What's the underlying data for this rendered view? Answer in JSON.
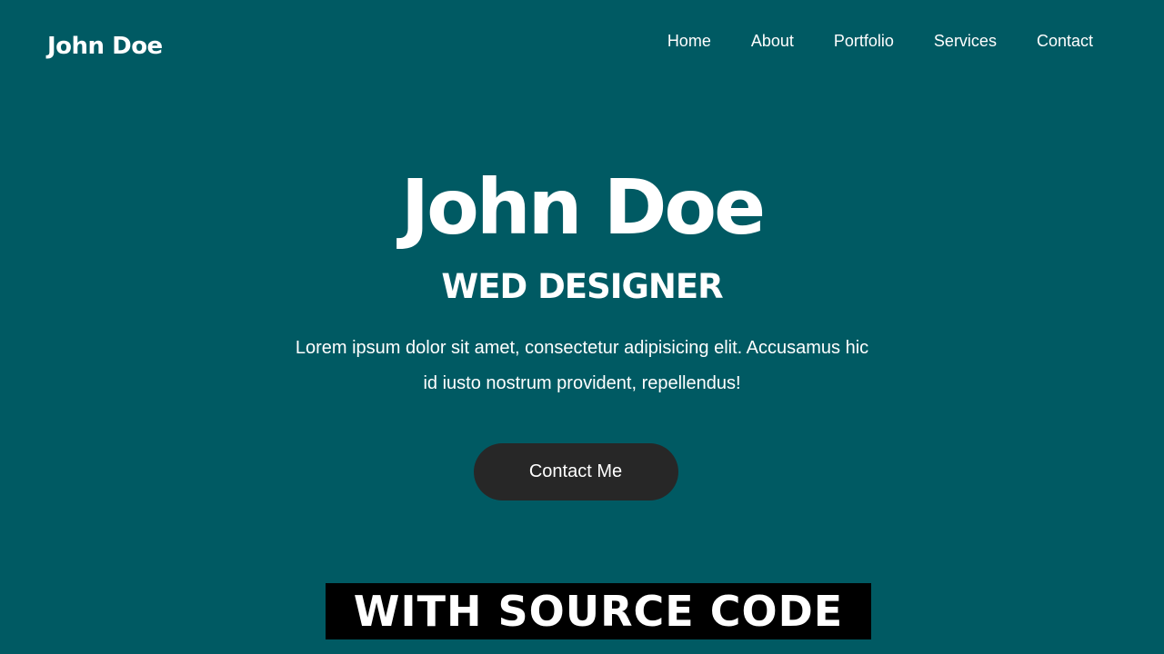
{
  "header": {
    "logo": "John Doe",
    "nav": [
      {
        "label": "Home"
      },
      {
        "label": "About"
      },
      {
        "label": "Portfolio"
      },
      {
        "label": "Services"
      },
      {
        "label": "Contact"
      }
    ]
  },
  "hero": {
    "title": "John Doe",
    "subtitle": "WED DESIGNER",
    "text": "Lorem ipsum dolor sit amet, consectetur adipisicing elit. Accusamus hic id iusto nostrum provident, repellendus!",
    "button_label": "Contact Me"
  },
  "banner": {
    "text": "WITH SOURCE CODE"
  },
  "colors": {
    "background": "#005a63",
    "button": "#272727",
    "banner": "#000000",
    "text": "#ffffff"
  }
}
